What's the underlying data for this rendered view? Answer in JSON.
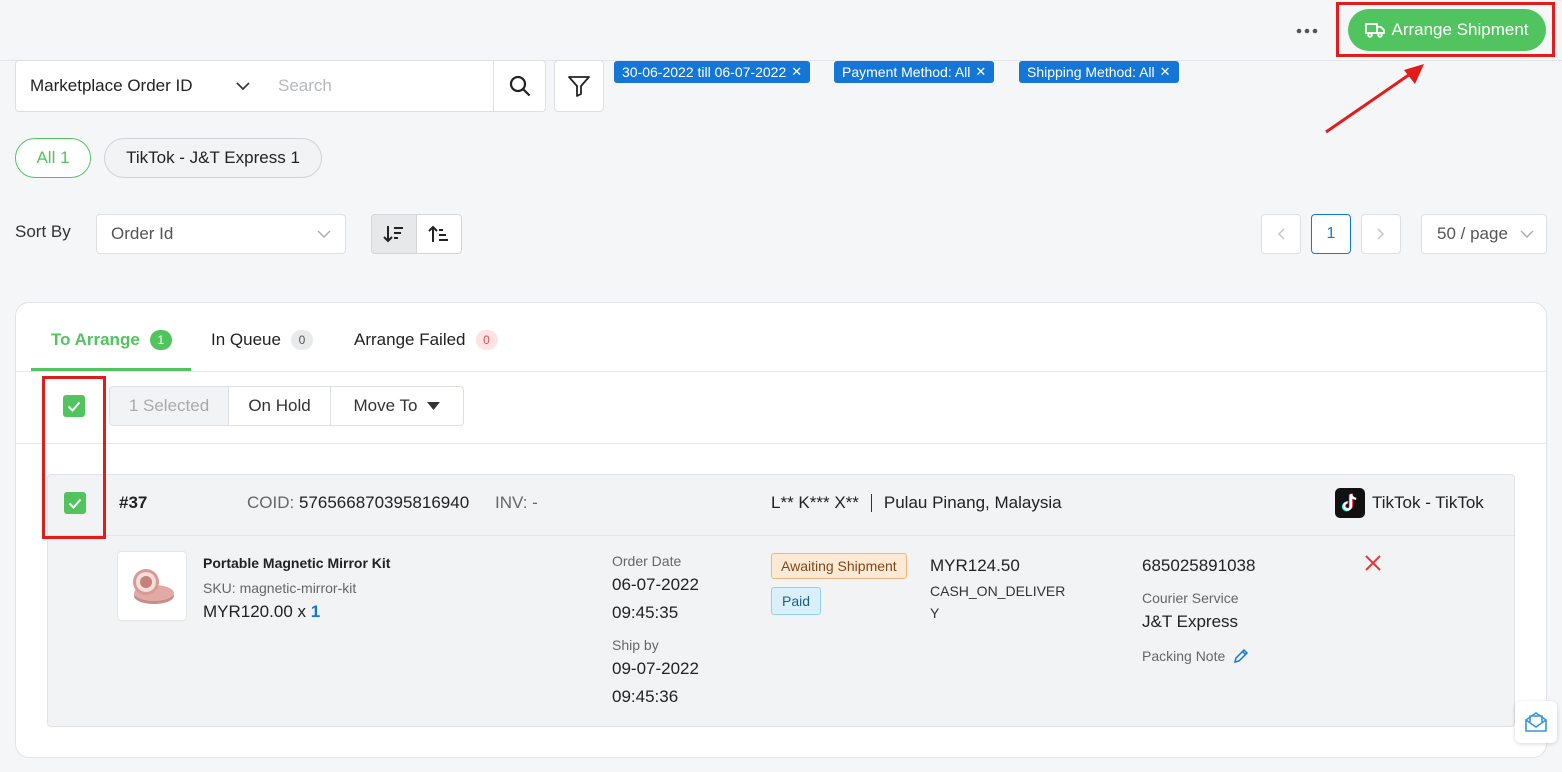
{
  "header": {
    "arrange_button": "Arrange Shipment",
    "more_icon": "more-horizontal-icon",
    "accent": "#52c45f"
  },
  "search": {
    "field_select": "Marketplace Order ID",
    "placeholder": "Search",
    "value": ""
  },
  "filters": {
    "chips": [
      "30-06-2022 till 06-07-2022",
      "Payment Method: All",
      "Shipping Method: All"
    ],
    "chip_color": "#1477d8"
  },
  "quick_tabs": {
    "all": "All 1",
    "tiktok": "TikTok - J&T Express 1"
  },
  "sort": {
    "label": "Sort By",
    "value": "Order Id"
  },
  "pagination": {
    "prev": "<",
    "current": "1",
    "next": ">",
    "per_page": "50 / page"
  },
  "tabs": [
    {
      "label": "To Arrange",
      "count": "1"
    },
    {
      "label": "In Queue",
      "count": "0"
    },
    {
      "label": "Arrange Failed",
      "count": "0"
    }
  ],
  "bulk": {
    "selected": "1 Selected",
    "on_hold": "On Hold",
    "move_to": "Move To"
  },
  "order": {
    "number": "#37",
    "coid_label": "COID:",
    "coid": "576566870395816940",
    "inv": "INV: -",
    "buyer": "L** K*** X**",
    "location": "Pulau Pinang, Malaysia",
    "store": "TikTok - TikTok",
    "product": {
      "name": "Portable Magnetic Mirror Kit",
      "sku": "SKU: magnetic-mirror-kit",
      "price": "MYR120.00 x",
      "qty": "1"
    },
    "order_date_label": "Order Date",
    "order_date": "06-07-2022",
    "order_time": "09:45:35",
    "ship_by_label": "Ship by",
    "ship_by_date": "09-07-2022",
    "ship_by_time": "09:45:36",
    "status": "Awaiting Shipment",
    "payment_status": "Paid",
    "amount": "MYR124.50",
    "payment_method": "CASH_ON_DELIVERY",
    "tracking": "685025891038",
    "courier_label": "Courier Service",
    "courier": "J&T Express",
    "packing_note_label": "Packing Note"
  }
}
